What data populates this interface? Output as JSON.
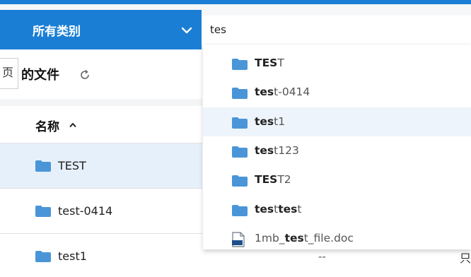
{
  "colors": {
    "accent": "#1a7fd4",
    "folder": "#4a95d8",
    "selected_row": "#e6f0fb"
  },
  "category": {
    "label": "所有类别"
  },
  "search": {
    "value": "tes"
  },
  "page_tab": {
    "label": "页"
  },
  "section": {
    "title": "的文件"
  },
  "columns": {
    "name": "名称"
  },
  "files": [
    {
      "name": "TEST",
      "selected": true
    },
    {
      "name": "test-0414",
      "selected": false
    },
    {
      "name": "test1",
      "selected": false
    }
  ],
  "bottom": {
    "dash": "--",
    "glyph": "只"
  },
  "suggestions": [
    {
      "match": "TES",
      "rest": "T",
      "icon": "folder-icon"
    },
    {
      "match": "tes",
      "rest": "t-0414",
      "icon": "folder-icon"
    },
    {
      "match": "tes",
      "rest": "t1",
      "icon": "folder-icon"
    },
    {
      "match": "tes",
      "rest": "t123",
      "icon": "folder-icon"
    },
    {
      "match": "TES",
      "rest": "T2",
      "icon": "folder-icon"
    },
    {
      "match": "tes",
      "rest": "t",
      "match2": "tes",
      "rest2": "t",
      "icon": "folder-icon"
    },
    {
      "prefix": "1mb_",
      "match": "tes",
      "rest": "t_file.doc",
      "icon": "doc-file-icon"
    }
  ]
}
